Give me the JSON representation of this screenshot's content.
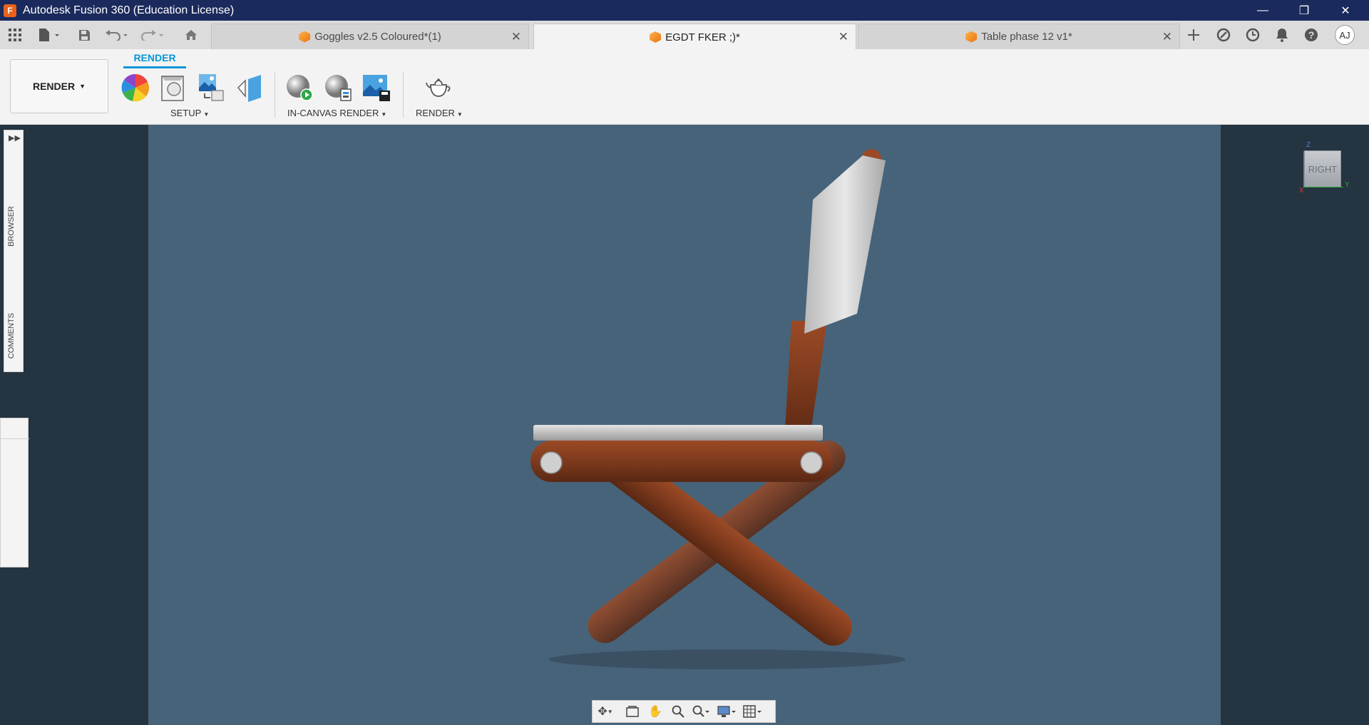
{
  "app": {
    "title": "Autodesk Fusion 360 (Education License)",
    "logo_letter": "F"
  },
  "window_controls": {
    "minimize": "—",
    "restore": "❐",
    "close": "✕"
  },
  "doc_tabs": [
    {
      "label": "Goggles v2.5 Coloured*(1)",
      "close": "✕"
    },
    {
      "label": "EGDT FKER ;)*",
      "close": "✕"
    },
    {
      "label": "Table phase 12 v1*",
      "close": "✕"
    }
  ],
  "user": {
    "initials": "AJ"
  },
  "ribbon": {
    "workspace": "RENDER",
    "tab": "RENDER",
    "groups": {
      "setup": "SETUP",
      "in_canvas": "IN-CANVAS RENDER",
      "render": "RENDER"
    }
  },
  "side_panel": {
    "browser": "BROWSER",
    "comments": "COMMENTS"
  },
  "viewcube": {
    "face": "RIGHT",
    "axis_z": "Z",
    "axis_y": "Y",
    "axis_x": "X"
  },
  "colors": {
    "accent": "#0696d7",
    "titlebar": "#1b2a5c",
    "canvas": "#46637a"
  }
}
